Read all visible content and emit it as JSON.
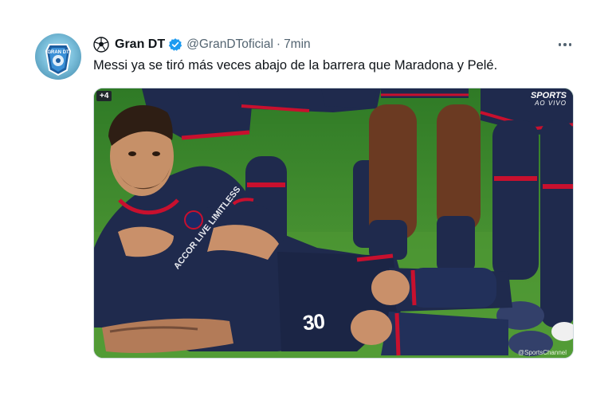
{
  "tweet": {
    "display_name": "Gran DT",
    "handle": "@GranDToficial",
    "separator": "·",
    "time": "7min",
    "text": "Messi ya se tiró más veces abajo de la barrera que Maradona y Pelé.",
    "verified": true,
    "avatar_text": "GRAN DT",
    "avatar_icon": "gran-dt-badge-icon",
    "more_icon": "more-options-icon"
  },
  "media": {
    "badge": "+4",
    "channel_logo_line1": "SPORTS",
    "channel_logo_line2": "AO VIVO",
    "jersey_number": "30",
    "sponsor_text": "ACCOR LIVE LIMITLESS",
    "credit": "@SportsChannel"
  },
  "colors": {
    "verified": "#1d9bf0",
    "secondary_text": "#536471",
    "primary_text": "#0f1419",
    "pitch": "#3f8a2c",
    "kit_navy": "#1f2a4d",
    "kit_red": "#c8102e"
  }
}
